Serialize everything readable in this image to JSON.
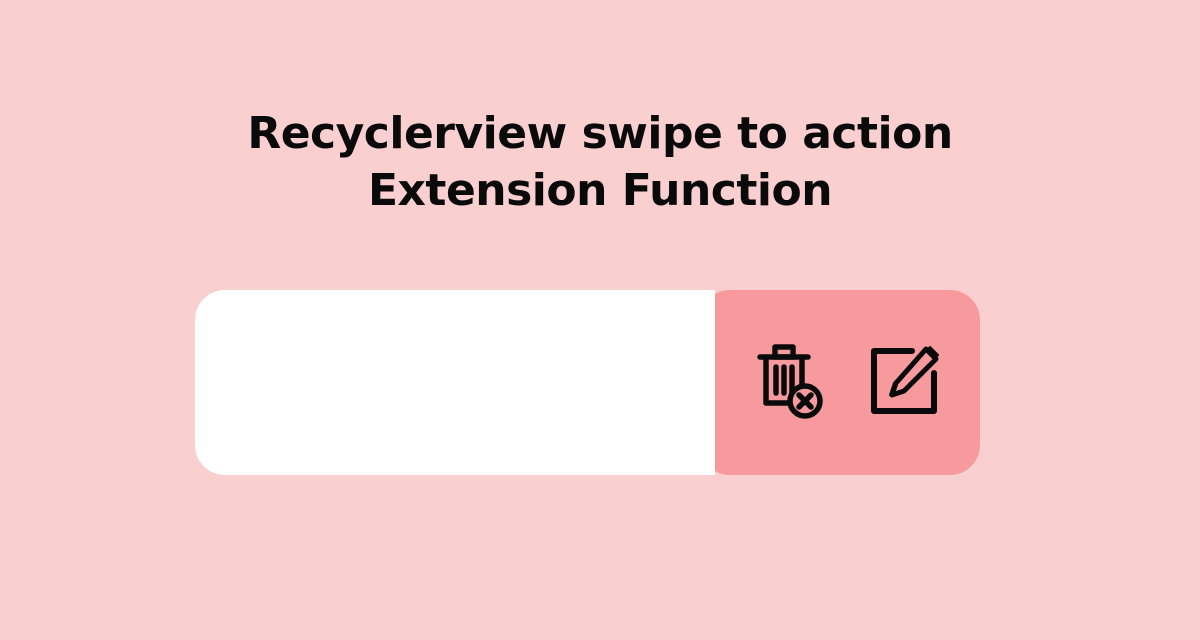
{
  "title": {
    "line1": "Recyclerview swipe to action",
    "line2": "Extension Function"
  },
  "actions": {
    "delete": "delete",
    "edit": "edit"
  },
  "colors": {
    "background": "#f9cfd0",
    "actionPanel": "#f79a9d",
    "card": "#ffffff",
    "text": "#0a0a0a",
    "iconStroke": "#0a0a0a"
  }
}
